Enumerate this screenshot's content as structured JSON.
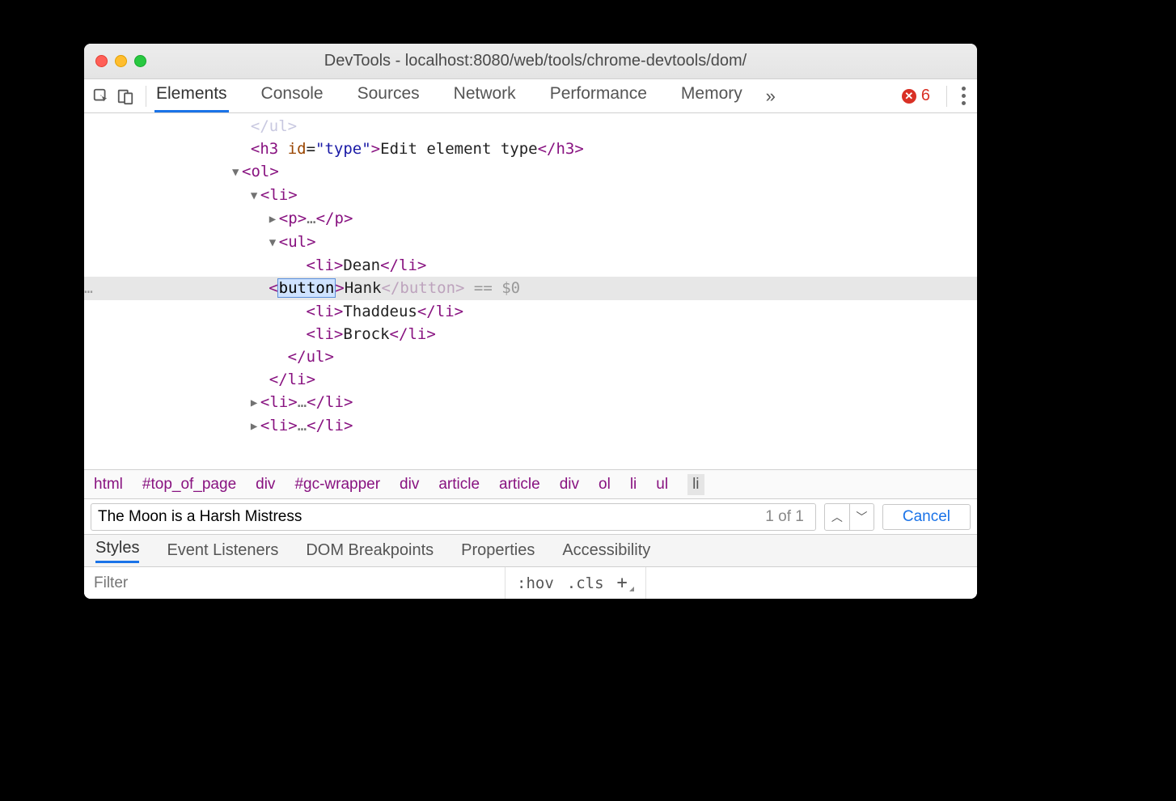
{
  "window": {
    "title": "DevTools - localhost:8080/web/tools/chrome-devtools/dom/"
  },
  "toolbar": {
    "tabs": [
      "Elements",
      "Console",
      "Sources",
      "Network",
      "Performance",
      "Memory"
    ],
    "overflow_glyph": "»",
    "error_count": "6"
  },
  "dom": {
    "closing_ul": "</ul>",
    "h3": {
      "open": "<h3 ",
      "attr_name": "id",
      "eq": "=",
      "attr_val": "\"type\"",
      "close": ">",
      "text": "Edit element type",
      "end": "</h3>"
    },
    "ol_open": "<ol>",
    "li_open": "<li>",
    "p_collapsed": {
      "open": "<p>",
      "dots": "…",
      "close": "</p>"
    },
    "ul_open": "<ul>",
    "items": [
      {
        "tag": "li",
        "text": "Dean"
      },
      {
        "tag_editing": "button",
        "close_tag": "button",
        "text": "Hank",
        "annot": " == $0"
      },
      {
        "tag": "li",
        "text": "Thaddeus"
      },
      {
        "tag": "li",
        "text": "Brock"
      }
    ],
    "ul_close": "</ul>",
    "li_close": "</li>",
    "li_collapsed": {
      "open": "<li>",
      "dots": "…",
      "close": "</li>"
    }
  },
  "breadcrumbs": [
    "html",
    "#top_of_page",
    "div",
    "#gc-wrapper",
    "div",
    "article",
    "article",
    "div",
    "ol",
    "li",
    "ul",
    "li"
  ],
  "search": {
    "value": "The Moon is a Harsh Mistress",
    "count": "1 of 1",
    "cancel": "Cancel"
  },
  "subtabs": [
    "Styles",
    "Event Listeners",
    "DOM Breakpoints",
    "Properties",
    "Accessibility"
  ],
  "stylebar": {
    "filter_placeholder": "Filter",
    "hov": ":hov",
    "cls": ".cls",
    "plus": "+"
  }
}
